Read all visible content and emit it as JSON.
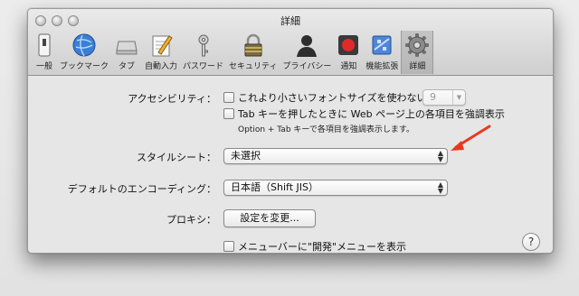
{
  "window": {
    "title": "詳細"
  },
  "toolbar": {
    "tabs": [
      {
        "label": "一般",
        "icon": "switch-icon"
      },
      {
        "label": "ブックマーク",
        "icon": "globe-icon"
      },
      {
        "label": "タブ",
        "icon": "tabs-icon"
      },
      {
        "label": "自動入力",
        "icon": "pencil-form-icon"
      },
      {
        "label": "パスワード",
        "icon": "key-icon"
      },
      {
        "label": "セキュリティ",
        "icon": "padlock-icon"
      },
      {
        "label": "プライバシー",
        "icon": "person-silhouette-icon"
      },
      {
        "label": "通知",
        "icon": "notification-icon"
      },
      {
        "label": "機能拡張",
        "icon": "puzzle-icon"
      },
      {
        "label": "詳細",
        "icon": "gear-icon"
      }
    ],
    "selected": "詳細"
  },
  "advanced": {
    "accessibility_label": "アクセシビリティ：",
    "min_font_checkbox": "これより小さいフォントサイズを使わない：",
    "min_font_value": "9",
    "tab_highlight_checkbox": "Tab キーを押したときに Web ページ上の各項目を強調表示",
    "tab_highlight_note": "Option + Tab キーで各項目を強調表示します。",
    "stylesheet_label": "スタイルシート：",
    "stylesheet_value": "未選択",
    "encoding_label": "デフォルトのエンコーディング：",
    "encoding_value": "日本語（Shift JIS）",
    "proxy_label": "プロキシ：",
    "proxy_button": "設定を変更...",
    "develop_menu_checkbox": "メニューバーに\"開発\"メニューを表示",
    "help_button": "?"
  },
  "annotation": {
    "arrow_color": "#e8391f"
  }
}
